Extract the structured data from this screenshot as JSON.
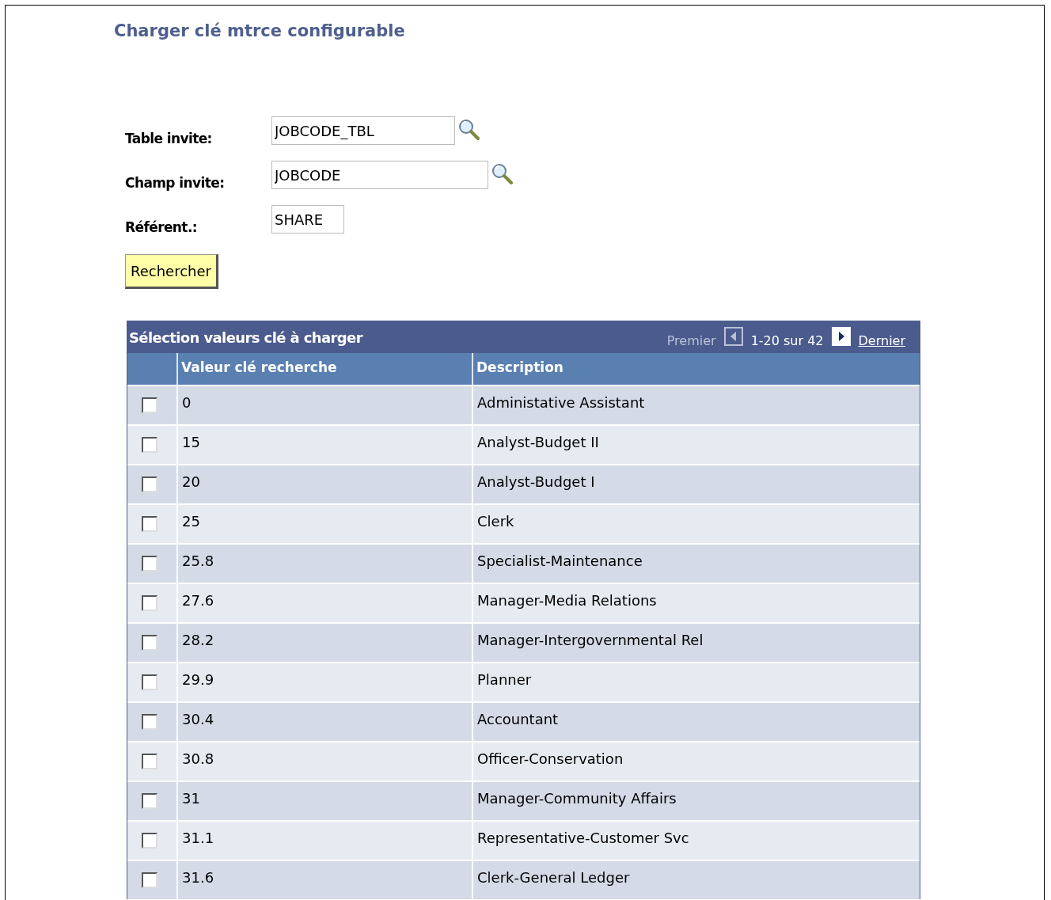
{
  "page_title": "Charger clé mtrce configurable",
  "fields": [
    {
      "label": "Table invite:",
      "value": "JOBCODE_TBL",
      "lookup": true,
      "kind": "wide"
    },
    {
      "label": "Champ invite:",
      "value": "JOBCODE",
      "lookup": true,
      "kind": "wider"
    },
    {
      "label": "Référent.:",
      "value": "SHARE",
      "lookup": false,
      "kind": "short"
    }
  ],
  "search_button": "Rechercher",
  "grid": {
    "title": "Sélection valeurs clé à charger",
    "pagination": {
      "first": {
        "label": "Premier",
        "disabled": true
      },
      "prev": {
        "disabled": true
      },
      "range": "1-20 sur 42",
      "next": {
        "disabled": false
      },
      "last": {
        "label": "Dernier",
        "disabled": false
      }
    },
    "columns": [
      "Valeur clé recherche",
      "Description"
    ],
    "rows": [
      {
        "checked": false,
        "key": "0",
        "description": "Administative Assistant"
      },
      {
        "checked": false,
        "key": "15",
        "description": "Analyst-Budget II"
      },
      {
        "checked": false,
        "key": "20",
        "description": "Analyst-Budget I"
      },
      {
        "checked": false,
        "key": "25",
        "description": "Clerk"
      },
      {
        "checked": false,
        "key": "25.8",
        "description": "Specialist-Maintenance"
      },
      {
        "checked": false,
        "key": "27.6",
        "description": "Manager-Media Relations"
      },
      {
        "checked": false,
        "key": "28.2",
        "description": "Manager-Intergovernmental Rel"
      },
      {
        "checked": false,
        "key": "29.9",
        "description": "Planner"
      },
      {
        "checked": false,
        "key": "30.4",
        "description": "Accountant"
      },
      {
        "checked": false,
        "key": "30.8",
        "description": "Officer-Conservation"
      },
      {
        "checked": false,
        "key": "31",
        "description": "Manager-Community Affairs"
      },
      {
        "checked": false,
        "key": "31.1",
        "description": "Representative-Customer Svc"
      },
      {
        "checked": false,
        "key": "31.6",
        "description": "Clerk-General Ledger"
      }
    ]
  }
}
